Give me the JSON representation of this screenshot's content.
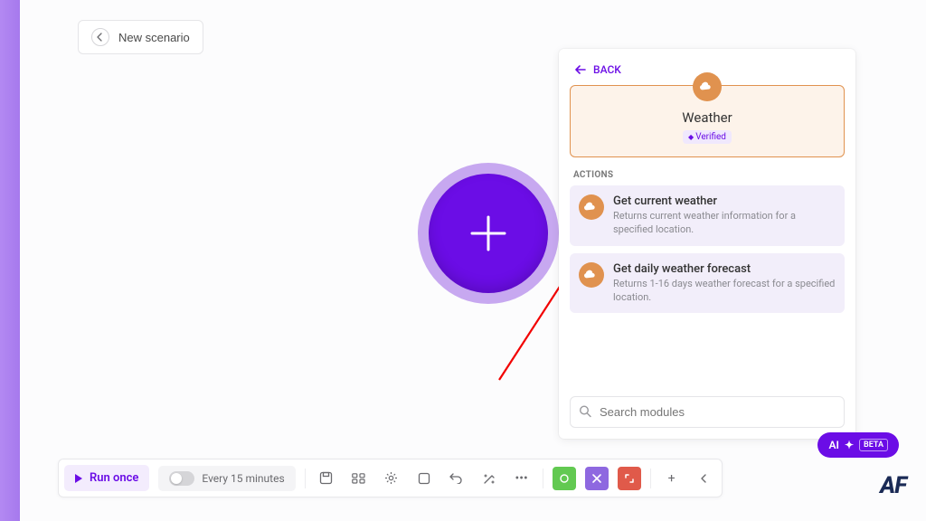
{
  "header": {
    "new_scenario": "New scenario"
  },
  "panel": {
    "back": "BACK",
    "app_name": "Weather",
    "verified": "Verified",
    "section_label": "ACTIONS",
    "actions": [
      {
        "title": "Get current weather",
        "desc": "Returns current weather information for a specified location."
      },
      {
        "title": "Get daily weather forecast",
        "desc": "Returns 1-16 days weather forecast for a specified location."
      }
    ],
    "search_placeholder": "Search modules"
  },
  "bottom": {
    "run_once": "Run once",
    "schedule": "Every 15 minutes"
  },
  "ai": {
    "label": "AI",
    "beta": "BETA"
  },
  "logo": "AF"
}
